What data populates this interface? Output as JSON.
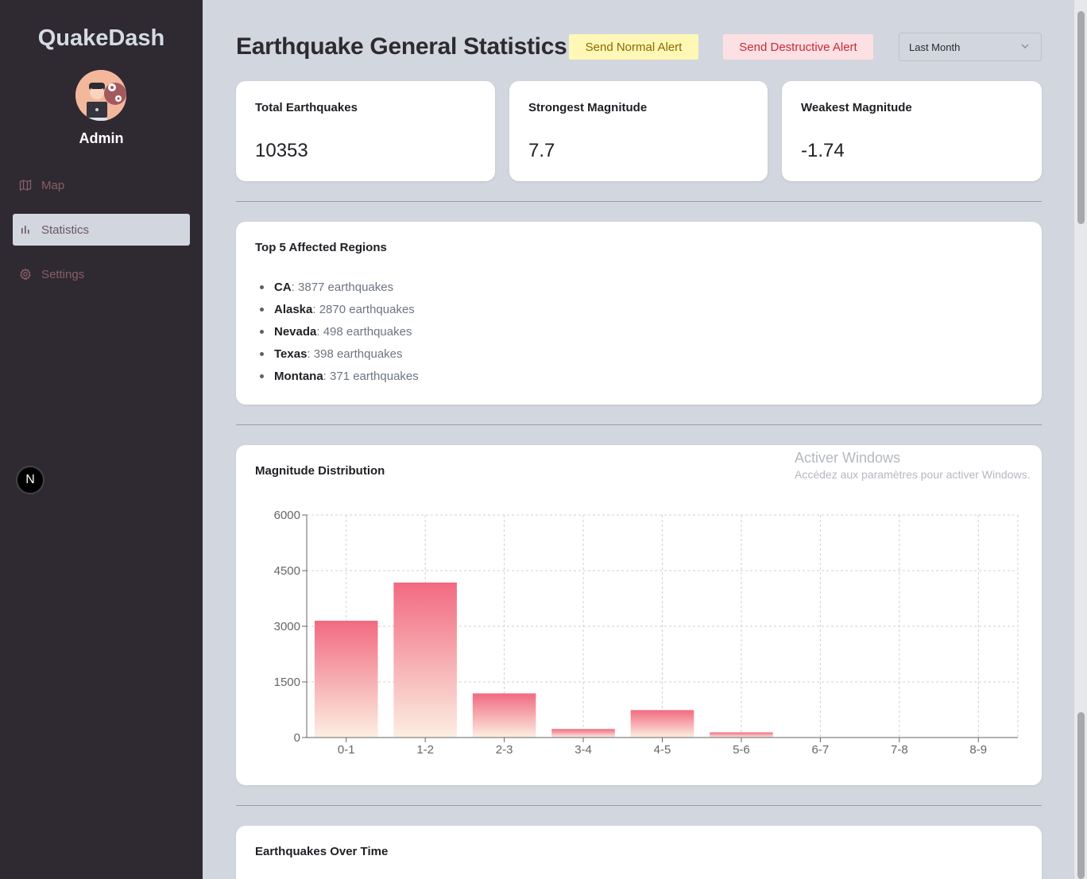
{
  "sidebar": {
    "brand": "QuakeDash",
    "user_role": "Admin",
    "items": [
      {
        "label": "Map",
        "icon": "map-icon",
        "active": false
      },
      {
        "label": "Statistics",
        "icon": "bar-chart-icon",
        "active": true
      },
      {
        "label": "Settings",
        "icon": "gear-icon",
        "active": false
      }
    ],
    "next_badge": "N"
  },
  "header": {
    "title": "Earthquake General Statistics",
    "normal_alert_label": "Send Normal Alert",
    "destructive_alert_label": "Send Destructive Alert",
    "period_selected": "Last Month"
  },
  "stats": [
    {
      "label": "Total Earthquakes",
      "value": "10353"
    },
    {
      "label": "Strongest Magnitude",
      "value": "7.7"
    },
    {
      "label": "Weakest Magnitude",
      "value": "-1.74"
    }
  ],
  "regions": {
    "title": "Top 5 Affected Regions",
    "items": [
      {
        "name": "CA",
        "count": ": 3877 earthquakes"
      },
      {
        "name": "Alaska",
        "count": ": 2870 earthquakes"
      },
      {
        "name": "Nevada",
        "count": ": 498 earthquakes"
      },
      {
        "name": "Texas",
        "count": ": 398 earthquakes"
      },
      {
        "name": "Montana",
        "count": ": 371 earthquakes"
      }
    ]
  },
  "distribution": {
    "title": "Magnitude Distribution"
  },
  "over_time": {
    "title": "Earthquakes Over Time"
  },
  "watermark": {
    "line1": "Activer Windows",
    "line2": "Accédez aux paramètres pour activer Windows."
  },
  "colors": {
    "sidebar_bg": "#2f2a32",
    "page_bg": "#d2d6de",
    "bar_top": "#f16a80",
    "bar_bottom": "#fcefe2",
    "nav_text": "#8a5e63"
  },
  "chart_data": {
    "type": "bar",
    "title": "Magnitude Distribution",
    "categories": [
      "0-1",
      "1-2",
      "2-3",
      "3-4",
      "4-5",
      "5-6",
      "6-7",
      "7-8",
      "8-9"
    ],
    "values": [
      3150,
      4180,
      1190,
      230,
      740,
      140,
      10,
      0,
      0
    ],
    "ylim": [
      0,
      6000
    ],
    "yticks": [
      0,
      1500,
      3000,
      4500,
      6000
    ],
    "grid": true,
    "legend": "none"
  }
}
